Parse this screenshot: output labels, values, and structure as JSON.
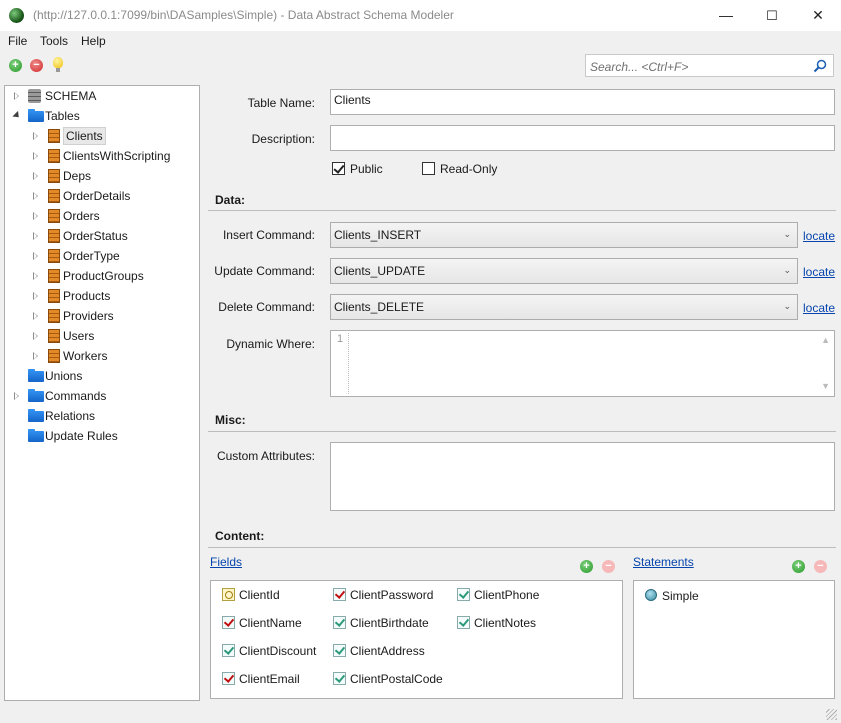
{
  "window": {
    "title": "(http://127.0.0.1:7099/bin\\DASamples\\Simple) - Data Abstract Schema Modeler",
    "controls": {
      "minimize": "—",
      "maximize": "☐",
      "close": "✕"
    }
  },
  "menu": {
    "items": [
      {
        "label": "File"
      },
      {
        "label": "Tools"
      },
      {
        "label": "Help"
      }
    ]
  },
  "toolbar": {
    "add_icon": "add-icon",
    "remove_icon": "remove-icon",
    "hint_icon": "lightbulb-icon",
    "search_placeholder": "Search... <Ctrl+F>"
  },
  "tree": {
    "schema_label": "SCHEMA",
    "tables_label": "Tables",
    "tables": [
      "Clients",
      "ClientsWithScripting",
      "Deps",
      "OrderDetails",
      "Orders",
      "OrderStatus",
      "OrderType",
      "ProductGroups",
      "Products",
      "Providers",
      "Users",
      "Workers"
    ],
    "selected": "Clients",
    "folders": [
      "Unions",
      "Commands",
      "Relations",
      "Update Rules"
    ]
  },
  "form": {
    "table_name_label": "Table Name:",
    "table_name": "Clients",
    "description_label": "Description:",
    "description": "",
    "public_label": "Public",
    "public_checked": true,
    "readonly_label": "Read-Only",
    "readonly_checked": false,
    "data_section": "Data:",
    "insert_label": "Insert Command:",
    "insert_value": "Clients_INSERT",
    "update_label": "Update Command:",
    "update_value": "Clients_UPDATE",
    "delete_label": "Delete Command:",
    "delete_value": "Clients_DELETE",
    "locate_label": "locate",
    "dynamic_where_label": "Dynamic Where:",
    "line_number": "1",
    "misc_section": "Misc:",
    "custom_attributes_label": "Custom Attributes:",
    "content_section": "Content:"
  },
  "fields": {
    "header": "Fields",
    "items": [
      {
        "name": "ClientId",
        "kind": "key"
      },
      {
        "name": "ClientName",
        "kind": "required"
      },
      {
        "name": "ClientDiscount",
        "kind": "optional"
      },
      {
        "name": "ClientEmail",
        "kind": "required"
      },
      {
        "name": "ClientPassword",
        "kind": "required"
      },
      {
        "name": "ClientBirthdate",
        "kind": "optional"
      },
      {
        "name": "ClientAddress",
        "kind": "optional"
      },
      {
        "name": "ClientPostalCode",
        "kind": "optional"
      },
      {
        "name": "ClientPhone",
        "kind": "optional"
      },
      {
        "name": "ClientNotes",
        "kind": "optional"
      }
    ]
  },
  "statements": {
    "header": "Statements",
    "items": [
      {
        "name": "Simple"
      }
    ]
  },
  "colors": {
    "link": "#0645ad",
    "folder": "#1e7ae0",
    "table_icon": "#e28a28"
  }
}
